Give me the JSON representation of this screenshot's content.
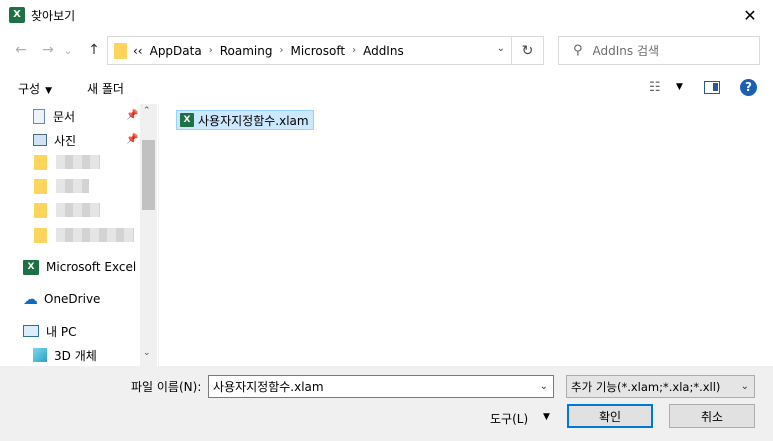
{
  "window": {
    "title": "찾아보기",
    "app_icon": "X",
    "close": "✕"
  },
  "nav": {
    "back": "←",
    "forward": "→",
    "history": "⌄",
    "up": "↑",
    "breadcrumb_overflow": "‹‹",
    "breadcrumb": [
      "AppData",
      "Roaming",
      "Microsoft",
      "AddIns"
    ],
    "breadcrumb_sep": "›",
    "address_dropdown": "⌄",
    "refresh": "↻",
    "search_placeholder": "AddIns 검색",
    "search_icon": "⚲"
  },
  "toolbar": {
    "organize": "구성",
    "organize_caret": "▼",
    "new_folder": "새 폴더",
    "view_icon": "☷",
    "view_caret": "▼",
    "help": "?"
  },
  "sidebar": {
    "items": [
      {
        "label": "문서",
        "icon": "📄",
        "pinned": true
      },
      {
        "label": "사진",
        "icon": "🖼",
        "pinned": true
      },
      {
        "label": "Microsoft Excel",
        "icon": "excel-icon"
      },
      {
        "label": "OneDrive",
        "icon": "☁"
      },
      {
        "label": "내 PC",
        "icon": "🖥"
      },
      {
        "label": "3D 개체",
        "icon": "cube-icon"
      }
    ],
    "pin_glyph": "📌",
    "scroll_up": "⌃",
    "scroll_down": "⌄"
  },
  "files": [
    {
      "name": "사용자지정함수.xlam",
      "selected": true,
      "icon": "excel-addin-icon"
    }
  ],
  "footer": {
    "filename_label": "파일 이름(N):",
    "filename_value": "사용자지정함수.xlam",
    "filetype_value": "추가 기능(*.xlam;*.xla;*.xll)",
    "tools_label": "도구(L)",
    "tools_caret": "▼",
    "ok_label": "확인",
    "cancel_label": "취소",
    "dropdown_glyph": "⌄"
  },
  "colors": {
    "accent": "#0078d7",
    "excel_green": "#1e7145",
    "folder": "#fed45c",
    "selection": "#cce8ff"
  }
}
